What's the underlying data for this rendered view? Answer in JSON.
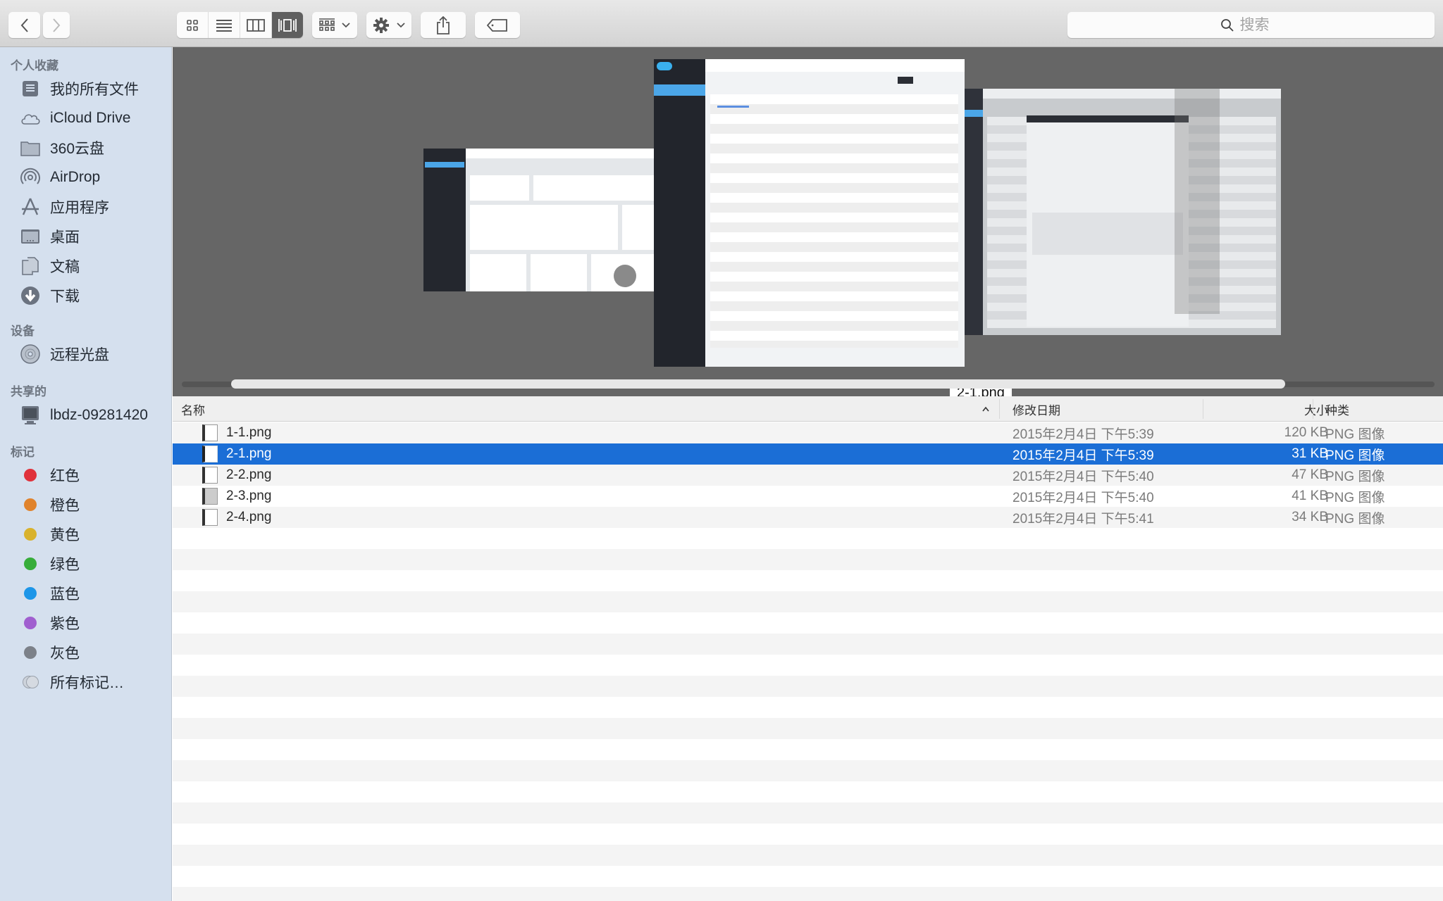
{
  "toolbar": {
    "back": "back",
    "forward": "forward",
    "view_modes": [
      "icon-view",
      "list-view",
      "column-view",
      "cover-flow-view"
    ],
    "active_view": "cover-flow-view",
    "search_placeholder": "搜索"
  },
  "sidebar": {
    "sections": [
      {
        "title": "个人收藏",
        "items": [
          {
            "label": "我的所有文件",
            "icon": "all-files-icon"
          },
          {
            "label": "iCloud Drive",
            "icon": "cloud-icon"
          },
          {
            "label": "360云盘",
            "icon": "folder-icon"
          },
          {
            "label": "AirDrop",
            "icon": "airdrop-icon"
          },
          {
            "label": "应用程序",
            "icon": "applications-icon"
          },
          {
            "label": "桌面",
            "icon": "desktop-icon"
          },
          {
            "label": "文稿",
            "icon": "documents-icon"
          },
          {
            "label": "下载",
            "icon": "download-icon"
          }
        ]
      },
      {
        "title": "设备",
        "items": [
          {
            "label": "远程光盘",
            "icon": "disc-icon"
          }
        ]
      },
      {
        "title": "共享的",
        "items": [
          {
            "label": "lbdz-09281420",
            "icon": "computer-icon"
          }
        ]
      },
      {
        "title": "标记",
        "items": [
          {
            "label": "红色",
            "color": "#e0313b"
          },
          {
            "label": "橙色",
            "color": "#e0832c"
          },
          {
            "label": "黄色",
            "color": "#d9b22c"
          },
          {
            "label": "绿色",
            "color": "#37ad3a"
          },
          {
            "label": "蓝色",
            "color": "#1d96e8"
          },
          {
            "label": "紫色",
            "color": "#a05fcf"
          },
          {
            "label": "灰色",
            "color": "#7c8189"
          },
          {
            "label": "所有标记…",
            "color": "all"
          }
        ]
      }
    ]
  },
  "coverflow": {
    "current_label": "2-1.png"
  },
  "list": {
    "columns": {
      "name": "名称",
      "date": "修改日期",
      "size": "大小",
      "kind": "种类"
    },
    "sort_indicator": "^",
    "files": [
      {
        "name": "1-1.png",
        "date": "2015年2月4日 下午5:39",
        "size": "120 KB",
        "kind": "PNG 图像",
        "selected": false
      },
      {
        "name": "2-1.png",
        "date": "2015年2月4日 下午5:39",
        "size": "31 KB",
        "kind": "PNG 图像",
        "selected": true
      },
      {
        "name": "2-2.png",
        "date": "2015年2月4日 下午5:40",
        "size": "47 KB",
        "kind": "PNG 图像",
        "selected": false
      },
      {
        "name": "2-3.png",
        "date": "2015年2月4日 下午5:40",
        "size": "41 KB",
        "kind": "PNG 图像",
        "selected": false
      },
      {
        "name": "2-4.png",
        "date": "2015年2月4日 下午5:41",
        "size": "34 KB",
        "kind": "PNG 图像",
        "selected": false
      }
    ]
  },
  "colors": {
    "selection": "#1b6ed6",
    "sidebar_bg": "#d5e0ee",
    "coverflow_bg": "#666666"
  }
}
